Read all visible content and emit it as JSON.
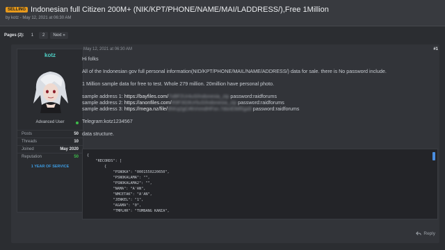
{
  "thread": {
    "prefix": "SELLING",
    "title": "Indonesian full Citizen 200M+ (NIK/KPT/PHONE/NAME/MAI/LADDRESS/),Free 1Million",
    "byline": "by kotz - May 12, 2021 at 06:30 AM"
  },
  "pagination": {
    "label": "Pages (2):",
    "pages": [
      "1",
      "2"
    ],
    "next": "Next »"
  },
  "post": {
    "date": "May 12, 2021 at 06:30 AM",
    "number": "#1",
    "lines": {
      "greeting": "Hi folks",
      "intro": "All of the Indonesian gov full personal information(NID/KPT/PHONE/MAIL/NAME/ADDRESS/) data for sale. there is No password include.",
      "sample_info": "1 Million sample data for free to test. Whole 279 million. 20million have personal photo.",
      "telegram": "Telegram:kotz1234567",
      "structure": "data structure."
    },
    "samples": [
      {
        "label": "sample address 1:",
        "url": "https://bayfiles.com/",
        "hidden": "7sBF2Ur4uS/indonesia_zip",
        "password": "password:raidforums"
      },
      {
        "label": "sample address 2:",
        "url": "https://anonfiles.com/",
        "hidden": "R9F3G9Ur5uS/indonesia_zip",
        "password": "password:raidforums"
      },
      {
        "label": "sample address 3:",
        "url": "https://mega.nz/file/",
        "hidden": "8hKq2gC#kVnmdHFsn.7dsnEiMRga9",
        "password": "password:raidforums"
      }
    ],
    "code_lines": [
      "{",
      "    \"RECORDS\": [",
      "        {",
      "            \"PSNOKA\": \"0001550220650\",",
      "            \"PSNOKALAMA\": \"\",",
      "            \"PSNOKALAMA2\": \"\",",
      "            \"NAMA\": \"A'AN\",",
      "            \"NMCETAK\": \"A'AN\",",
      "            \"JENKEL\": \"1\",",
      "            \"AGAMA\": \"0\",",
      "            \"TMPLHR\": \"TUMBANG KANIA\","
    ],
    "reply_label": "Reply"
  },
  "user": {
    "name": "kotz",
    "title": "Advanced User",
    "stats": [
      {
        "label": "Posts",
        "value": "50"
      },
      {
        "label": "Threads",
        "value": "10"
      },
      {
        "label": "Joined",
        "value": "May 2020"
      },
      {
        "label": "Reputation",
        "value": "50"
      }
    ],
    "service": "1 YEAR OF SERVICE"
  },
  "colors": {
    "background": "#2b2d31",
    "prefix_badge": "#e89a1c",
    "username": "#4fd3c8",
    "online": "#3dbb4a",
    "service_badge": "#3d9be0",
    "scrollbar": "#4a8ee0"
  },
  "icons": [
    "reply-icon",
    "online-status-icon"
  ]
}
